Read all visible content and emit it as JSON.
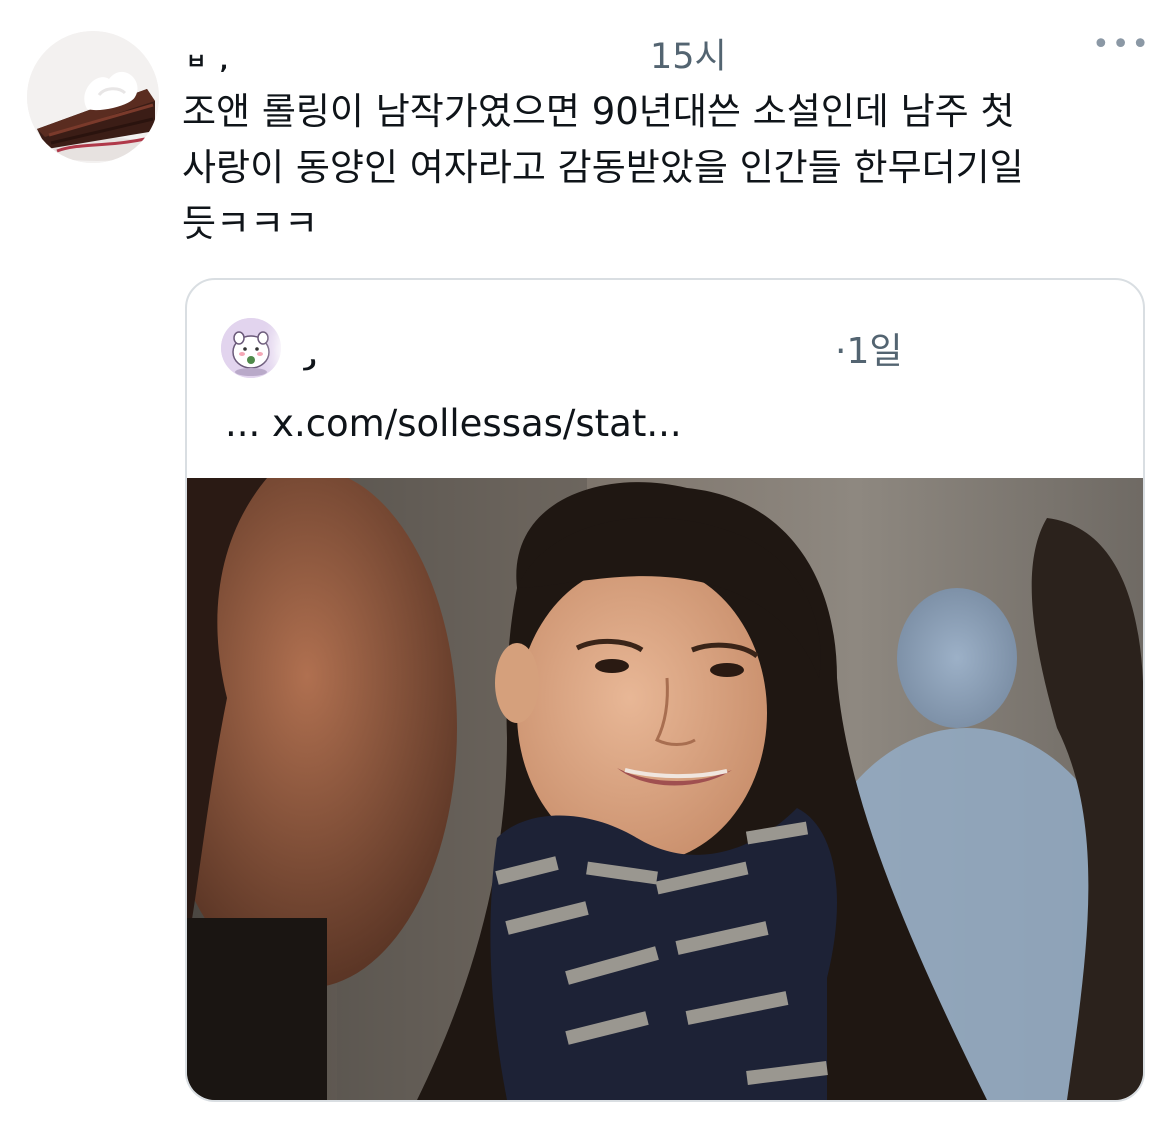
{
  "tweet": {
    "author": {
      "name_stub": "ㅂ ,",
      "avatar_icon": "chocolate-pie-avatar"
    },
    "time": "15시",
    "more_icon": "more-dots-icon",
    "more_label": "•••",
    "text": "조앤 롤링이 남작가였으면 90년대쓴 소설인데 남주 첫\n사랑이 동양인 여자라고 감동받았을 인간들 한무더기일\n듯ㅋㅋㅋ"
  },
  "quote": {
    "author": {
      "name_stub": "ر",
      "avatar_icon": "cartoon-character-avatar"
    },
    "time": "·1일",
    "link": "... x.com/sollessas/stat...",
    "media_icon": "photo-girl-in-striped-scarf"
  },
  "colors": {
    "text": "#0f1419",
    "secondary": "#536471",
    "border": "#d9dee2"
  }
}
